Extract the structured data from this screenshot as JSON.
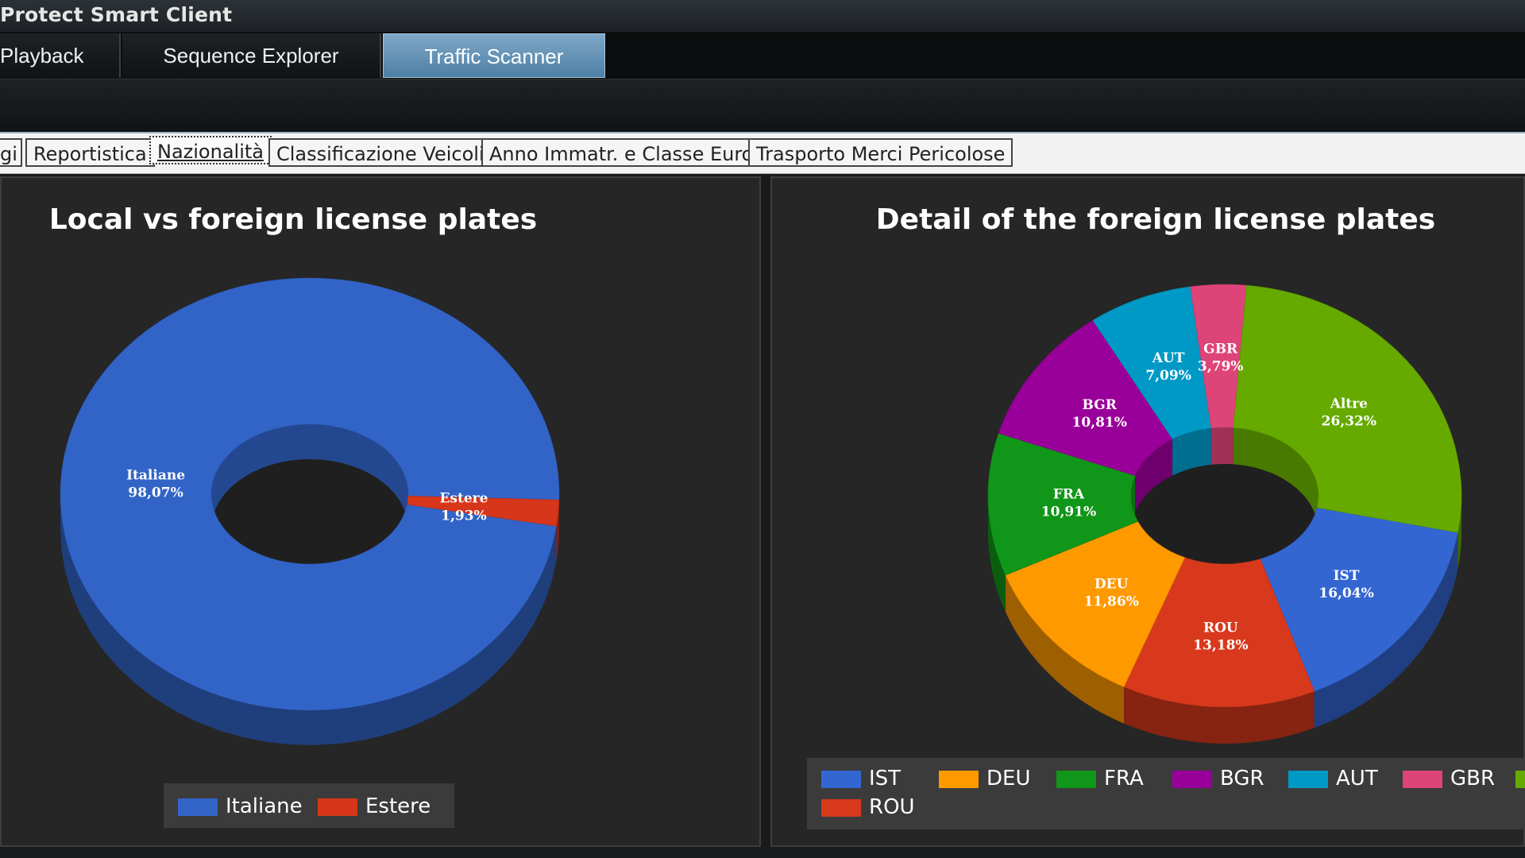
{
  "app": {
    "title": "Protect Smart Client"
  },
  "main_tabs": [
    {
      "label": "Playback",
      "active": false
    },
    {
      "label": "Sequence Explorer",
      "active": false
    },
    {
      "label": "Traffic Scanner",
      "active": true
    }
  ],
  "sub_tabs": [
    {
      "label": "gi",
      "active": false
    },
    {
      "label": "Reportistica",
      "active": false
    },
    {
      "label": "Nazionalità",
      "active": true
    },
    {
      "label": "Classificazione Veicoli",
      "active": false
    },
    {
      "label": "Anno Immatr. e Classe Euro",
      "active": false
    },
    {
      "label": "Trasporto Merci Pericolose",
      "active": false
    }
  ],
  "chart_data": [
    {
      "type": "pie",
      "variant": "donut-3d",
      "title": "Local vs foreign license plates",
      "slices": [
        {
          "label": "Italiane",
          "value_label": "98,07%",
          "value": 98.07,
          "color": "#3264c8"
        },
        {
          "label": "Estere",
          "value_label": "1,93%",
          "value": 1.93,
          "color": "#d7361a"
        }
      ],
      "legend": [
        "Italiane",
        "Estere"
      ],
      "legend_position": "bottom"
    },
    {
      "type": "pie",
      "variant": "donut-3d",
      "title": "Detail of the foreign license plates",
      "slices": [
        {
          "label": "IST",
          "value_label": "16,04%",
          "value": 16.04,
          "color": "#3366d1"
        },
        {
          "label": "ROU",
          "value_label": "13,18%",
          "value": 13.18,
          "color": "#d8391c"
        },
        {
          "label": "DEU",
          "value_label": "11,86%",
          "value": 11.86,
          "color": "#ff9900"
        },
        {
          "label": "FRA",
          "value_label": "10,91%",
          "value": 10.91,
          "color": "#109618"
        },
        {
          "label": "BGR",
          "value_label": "10,81%",
          "value": 10.81,
          "color": "#990099"
        },
        {
          "label": "AUT",
          "value_label": "7,09%",
          "value": 7.09,
          "color": "#0099c6"
        },
        {
          "label": "GBR",
          "value_label": "3,79%",
          "value": 3.79,
          "color": "#dd4477"
        },
        {
          "label": "Altre",
          "value_label": "26,32%",
          "value": 26.32,
          "color": "#66aa00"
        }
      ],
      "legend": [
        "IST",
        "DEU",
        "FRA",
        "BGR",
        "AUT",
        "GBR",
        "ROU"
      ],
      "legend_position": "bottom"
    }
  ]
}
